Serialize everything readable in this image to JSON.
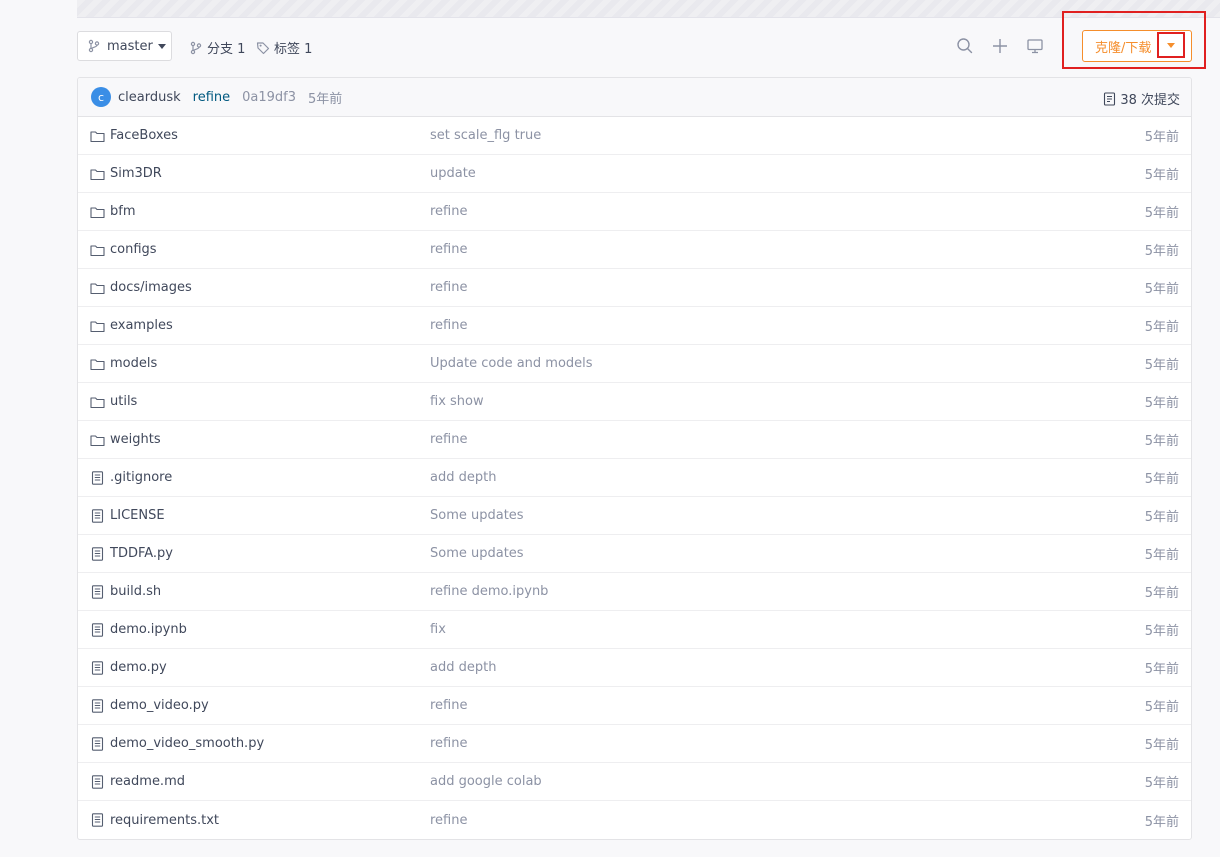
{
  "toolbar": {
    "branch": "master",
    "branches_label": "分支 1",
    "tags_label": "标签 1",
    "clone_label": "克隆/下载"
  },
  "commit": {
    "avatar_letter": "c",
    "author": "cleardusk",
    "message": "refine",
    "sha": "0a19df3",
    "ago": "5年前",
    "count_label": "38 次提交"
  },
  "files": [
    {
      "name": "FaceBoxes",
      "type": "folder",
      "message": "set scale_flg true",
      "time": "5年前"
    },
    {
      "name": "Sim3DR",
      "type": "folder",
      "message": "update",
      "time": "5年前"
    },
    {
      "name": "bfm",
      "type": "folder",
      "message": "refine",
      "time": "5年前"
    },
    {
      "name": "configs",
      "type": "folder",
      "message": "refine",
      "time": "5年前"
    },
    {
      "name": "docs/images",
      "type": "folder",
      "message": "refine",
      "time": "5年前"
    },
    {
      "name": "examples",
      "type": "folder",
      "message": "refine",
      "time": "5年前"
    },
    {
      "name": "models",
      "type": "folder",
      "message": "Update code and models",
      "time": "5年前"
    },
    {
      "name": "utils",
      "type": "folder",
      "message": "fix show",
      "time": "5年前"
    },
    {
      "name": "weights",
      "type": "folder",
      "message": "refine",
      "time": "5年前"
    },
    {
      "name": ".gitignore",
      "type": "file",
      "message": "add depth",
      "time": "5年前"
    },
    {
      "name": "LICENSE",
      "type": "file",
      "message": "Some updates",
      "time": "5年前"
    },
    {
      "name": "TDDFA.py",
      "type": "file",
      "message": "Some updates",
      "time": "5年前"
    },
    {
      "name": "build.sh",
      "type": "file",
      "message": "refine demo.ipynb",
      "time": "5年前"
    },
    {
      "name": "demo.ipynb",
      "type": "file",
      "message": "fix",
      "time": "5年前"
    },
    {
      "name": "demo.py",
      "type": "file",
      "message": "add depth",
      "time": "5年前"
    },
    {
      "name": "demo_video.py",
      "type": "file",
      "message": "refine",
      "time": "5年前"
    },
    {
      "name": "demo_video_smooth.py",
      "type": "file",
      "message": "refine",
      "time": "5年前"
    },
    {
      "name": "readme.md",
      "type": "file",
      "message": "add google colab",
      "time": "5年前"
    },
    {
      "name": "requirements.txt",
      "type": "file",
      "message": "refine",
      "time": "5年前"
    }
  ],
  "icons": {
    "branch": "branch-icon",
    "tag": "tag-icon",
    "search": "search-icon",
    "add": "plus-icon",
    "webide": "monitor-icon",
    "folder": "folder-icon",
    "file": "file-icon",
    "commits": "commit-list-icon"
  },
  "colors": {
    "accent": "#f58e2c",
    "highlight": "#e02020",
    "link": "#005980",
    "avatar": "#3a8ee6",
    "muted": "#8c92a4"
  }
}
